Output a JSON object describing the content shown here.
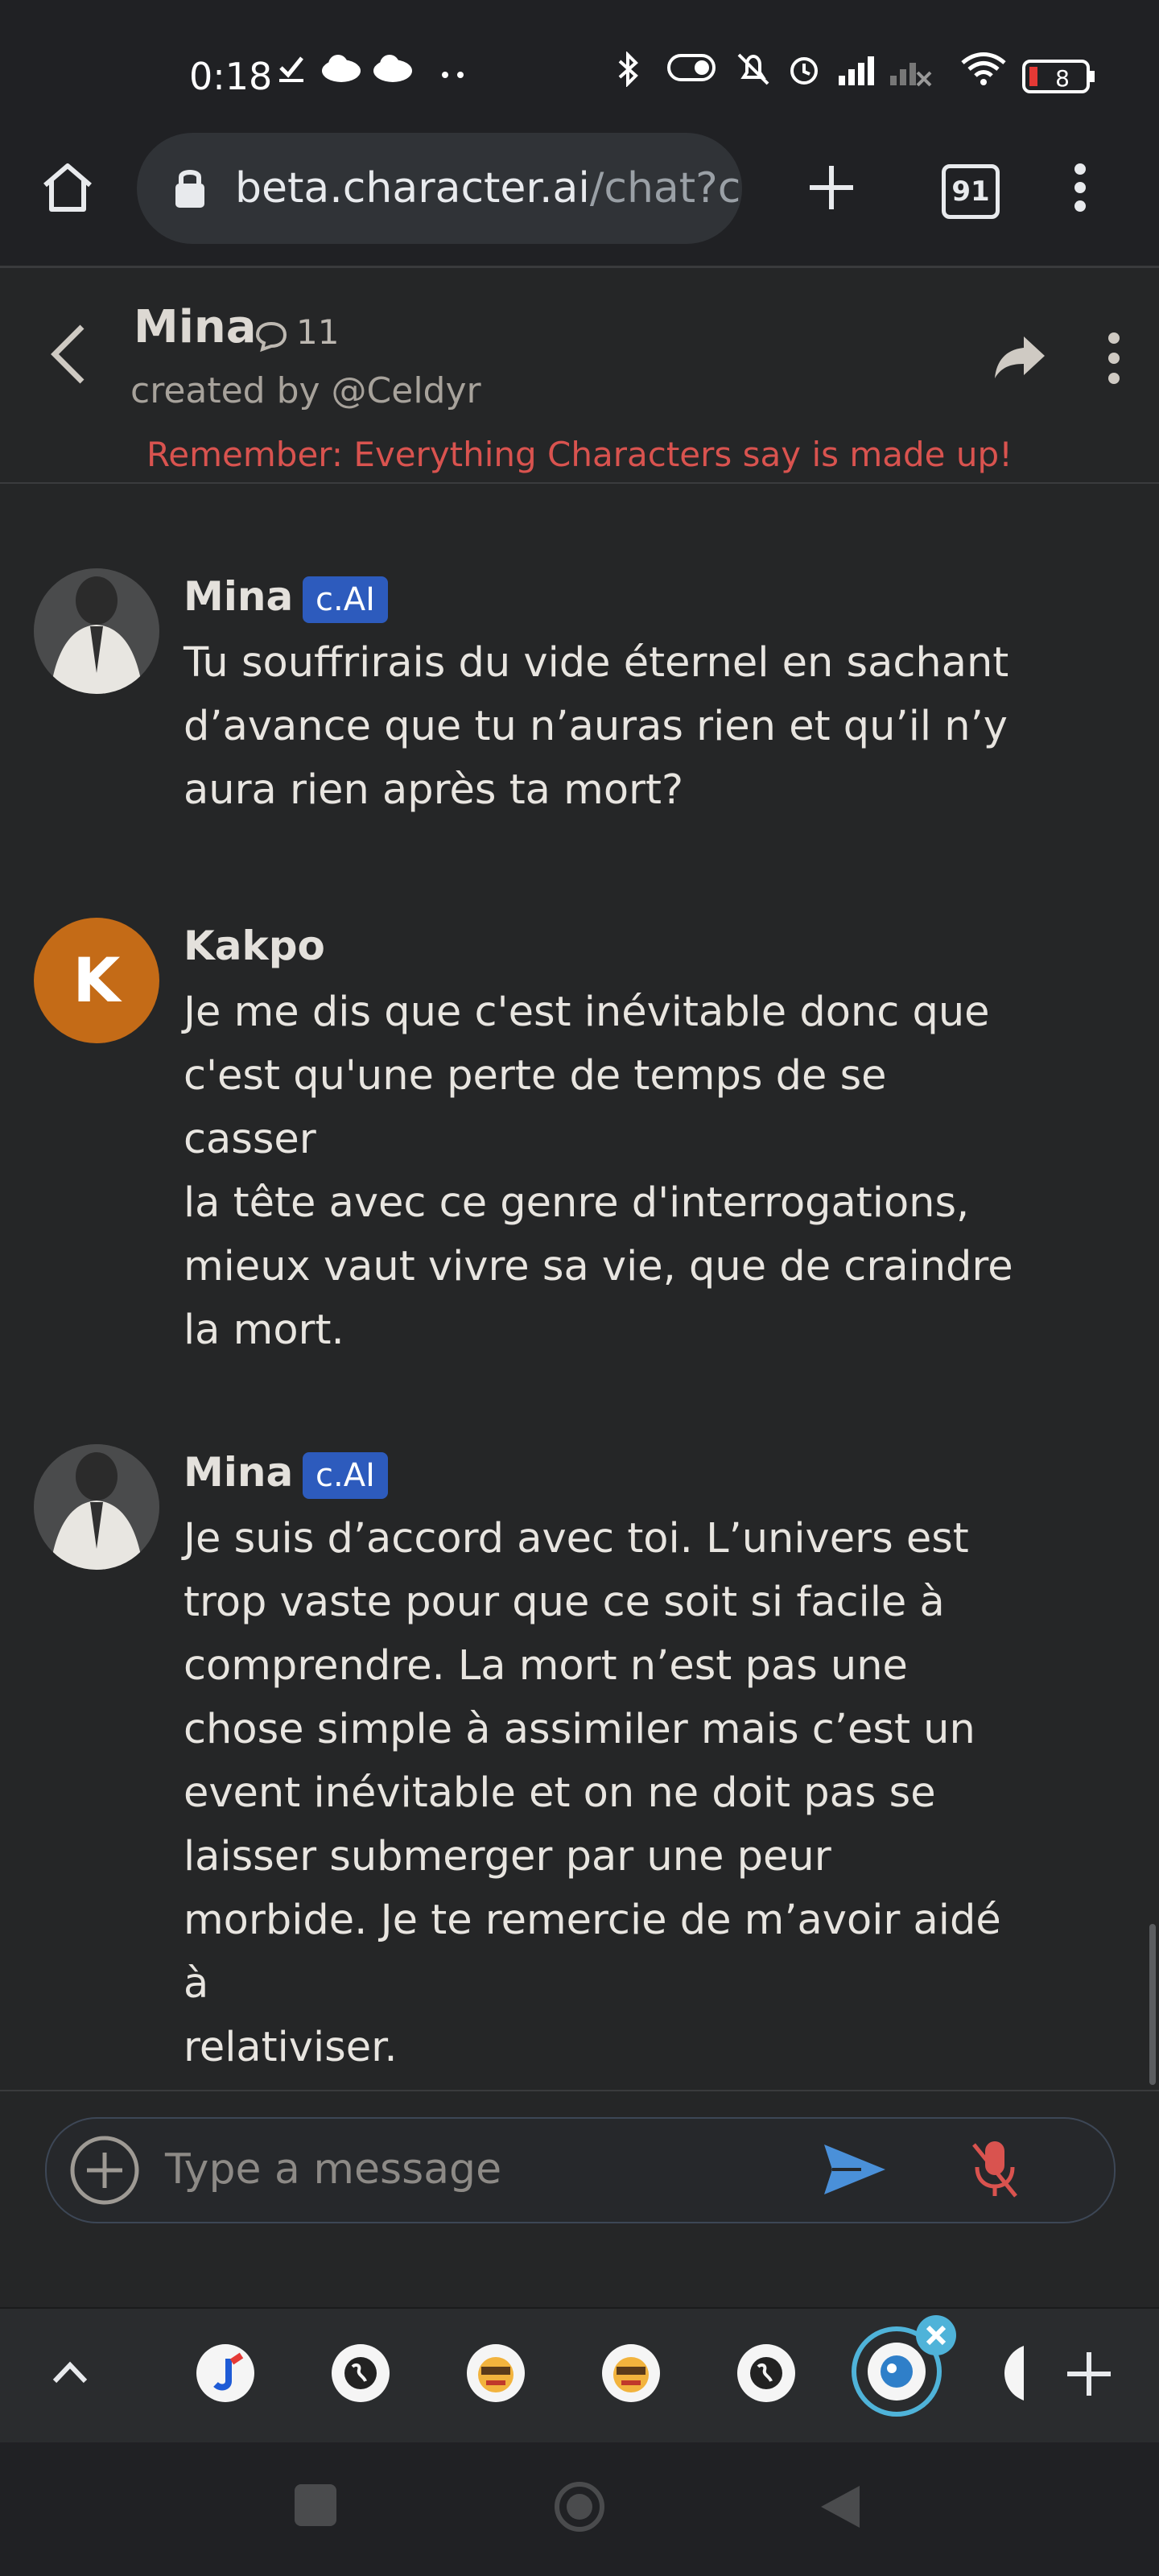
{
  "status_bar": {
    "time": "0:18",
    "battery": "8"
  },
  "browser": {
    "url_host": "beta.character.ai",
    "url_path": "/chat?c",
    "tab_count": "91"
  },
  "header": {
    "name": "Mina",
    "chat_count": "11",
    "creator": "created by @Celdyr",
    "disclaimer": "Remember: Everything Characters say is made up!"
  },
  "messages": [
    {
      "author": "Mina",
      "badge": "c.AI",
      "text": "Tu souffrirais du vide éternel en sachant\nd’avance que tu n’auras rien et qu’il n’y\naura rien après ta mort?"
    },
    {
      "author": "Kakpo",
      "avatar_letter": "K",
      "avatar_color": "#c46b17",
      "text": "Je me dis que c'est inévitable donc que\nc'est qu'une perte de temps de se casser\nla tête avec ce genre d'interrogations,\nmieux vaut vivre sa vie, que de craindre\nla mort."
    },
    {
      "author": "Mina",
      "badge": "c.AI",
      "text": "Je suis d’accord avec toi. L’univers est\ntrop vaste pour que ce soit si facile à\ncomprendre. La mort n’est pas une\nchose simple à assimiler mais c’est un\nevent inévitable et on ne doit pas se\nlaisser submerger par une peur\nmorbide. Je te remercie de m’avoir aidé à\nrelativiser."
    }
  ],
  "input": {
    "placeholder": "Type a message"
  },
  "colors": {
    "background": "#252627",
    "disclaimer": "#d9534f",
    "badge": "#2d5bbd",
    "send": "#4a90d9",
    "mic_muted": "#d9534f"
  }
}
